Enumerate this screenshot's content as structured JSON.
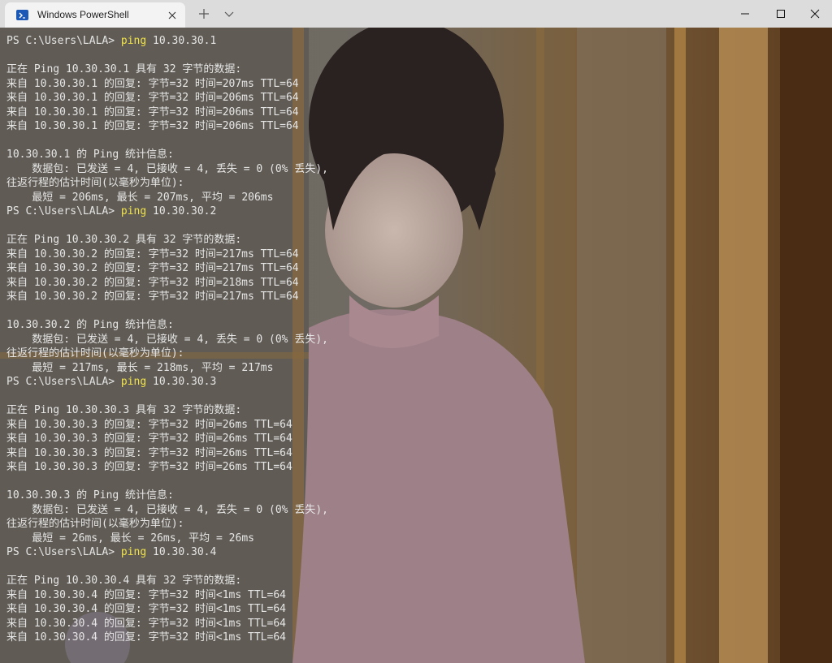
{
  "window": {
    "tab_title": "Windows PowerShell",
    "tab_icon": "powershell-icon",
    "controls": [
      "new-tab-icon",
      "chevron-down-icon",
      "minimize-icon",
      "maximize-icon",
      "close-icon"
    ],
    "colors": {
      "titlebar": "#dcdcdc",
      "tab": "#f3f3f3",
      "prompt_cmd": "#f0e24a",
      "text": "#e6e6e6"
    }
  },
  "terminal": {
    "lines": [
      {
        "prompt": "PS C:\\Users\\LALA> ",
        "cmd": "ping",
        "args": " 10.30.30.1"
      },
      {
        "text": ""
      },
      {
        "text": "正在 Ping 10.30.30.1 具有 32 字节的数据:"
      },
      {
        "text": "来自 10.30.30.1 的回复: 字节=32 时间=207ms TTL=64"
      },
      {
        "text": "来自 10.30.30.1 的回复: 字节=32 时间=206ms TTL=64"
      },
      {
        "text": "来自 10.30.30.1 的回复: 字节=32 时间=206ms TTL=64"
      },
      {
        "text": "来自 10.30.30.1 的回复: 字节=32 时间=206ms TTL=64"
      },
      {
        "text": ""
      },
      {
        "text": "10.30.30.1 的 Ping 统计信息:"
      },
      {
        "text": "    数据包: 已发送 = 4, 已接收 = 4, 丢失 = 0 (0% 丢失),"
      },
      {
        "text": "往返行程的估计时间(以毫秒为单位):"
      },
      {
        "text": "    最短 = 206ms, 最长 = 207ms, 平均 = 206ms"
      },
      {
        "prompt": "PS C:\\Users\\LALA> ",
        "cmd": "ping",
        "args": " 10.30.30.2"
      },
      {
        "text": ""
      },
      {
        "text": "正在 Ping 10.30.30.2 具有 32 字节的数据:"
      },
      {
        "text": "来自 10.30.30.2 的回复: 字节=32 时间=217ms TTL=64"
      },
      {
        "text": "来自 10.30.30.2 的回复: 字节=32 时间=217ms TTL=64"
      },
      {
        "text": "来自 10.30.30.2 的回复: 字节=32 时间=218ms TTL=64"
      },
      {
        "text": "来自 10.30.30.2 的回复: 字节=32 时间=217ms TTL=64"
      },
      {
        "text": ""
      },
      {
        "text": "10.30.30.2 的 Ping 统计信息:"
      },
      {
        "text": "    数据包: 已发送 = 4, 已接收 = 4, 丢失 = 0 (0% 丢失),"
      },
      {
        "text": "往返行程的估计时间(以毫秒为单位):"
      },
      {
        "text": "    最短 = 217ms, 最长 = 218ms, 平均 = 217ms"
      },
      {
        "prompt": "PS C:\\Users\\LALA> ",
        "cmd": "ping",
        "args": " 10.30.30.3"
      },
      {
        "text": ""
      },
      {
        "text": "正在 Ping 10.30.30.3 具有 32 字节的数据:"
      },
      {
        "text": "来自 10.30.30.3 的回复: 字节=32 时间=26ms TTL=64"
      },
      {
        "text": "来自 10.30.30.3 的回复: 字节=32 时间=26ms TTL=64"
      },
      {
        "text": "来自 10.30.30.3 的回复: 字节=32 时间=26ms TTL=64"
      },
      {
        "text": "来自 10.30.30.3 的回复: 字节=32 时间=26ms TTL=64"
      },
      {
        "text": ""
      },
      {
        "text": "10.30.30.3 的 Ping 统计信息:"
      },
      {
        "text": "    数据包: 已发送 = 4, 已接收 = 4, 丢失 = 0 (0% 丢失),"
      },
      {
        "text": "往返行程的估计时间(以毫秒为单位):"
      },
      {
        "text": "    最短 = 26ms, 最长 = 26ms, 平均 = 26ms"
      },
      {
        "prompt": "PS C:\\Users\\LALA> ",
        "cmd": "ping",
        "args": " 10.30.30.4"
      },
      {
        "text": ""
      },
      {
        "text": "正在 Ping 10.30.30.4 具有 32 字节的数据:"
      },
      {
        "text": "来自 10.30.30.4 的回复: 字节=32 时间<1ms TTL=64"
      },
      {
        "text": "来自 10.30.30.4 的回复: 字节=32 时间<1ms TTL=64"
      },
      {
        "text": "来自 10.30.30.4 的回复: 字节=32 时间<1ms TTL=64"
      },
      {
        "text": "来自 10.30.30.4 的回复: 字节=32 时间<1ms TTL=64"
      }
    ]
  }
}
